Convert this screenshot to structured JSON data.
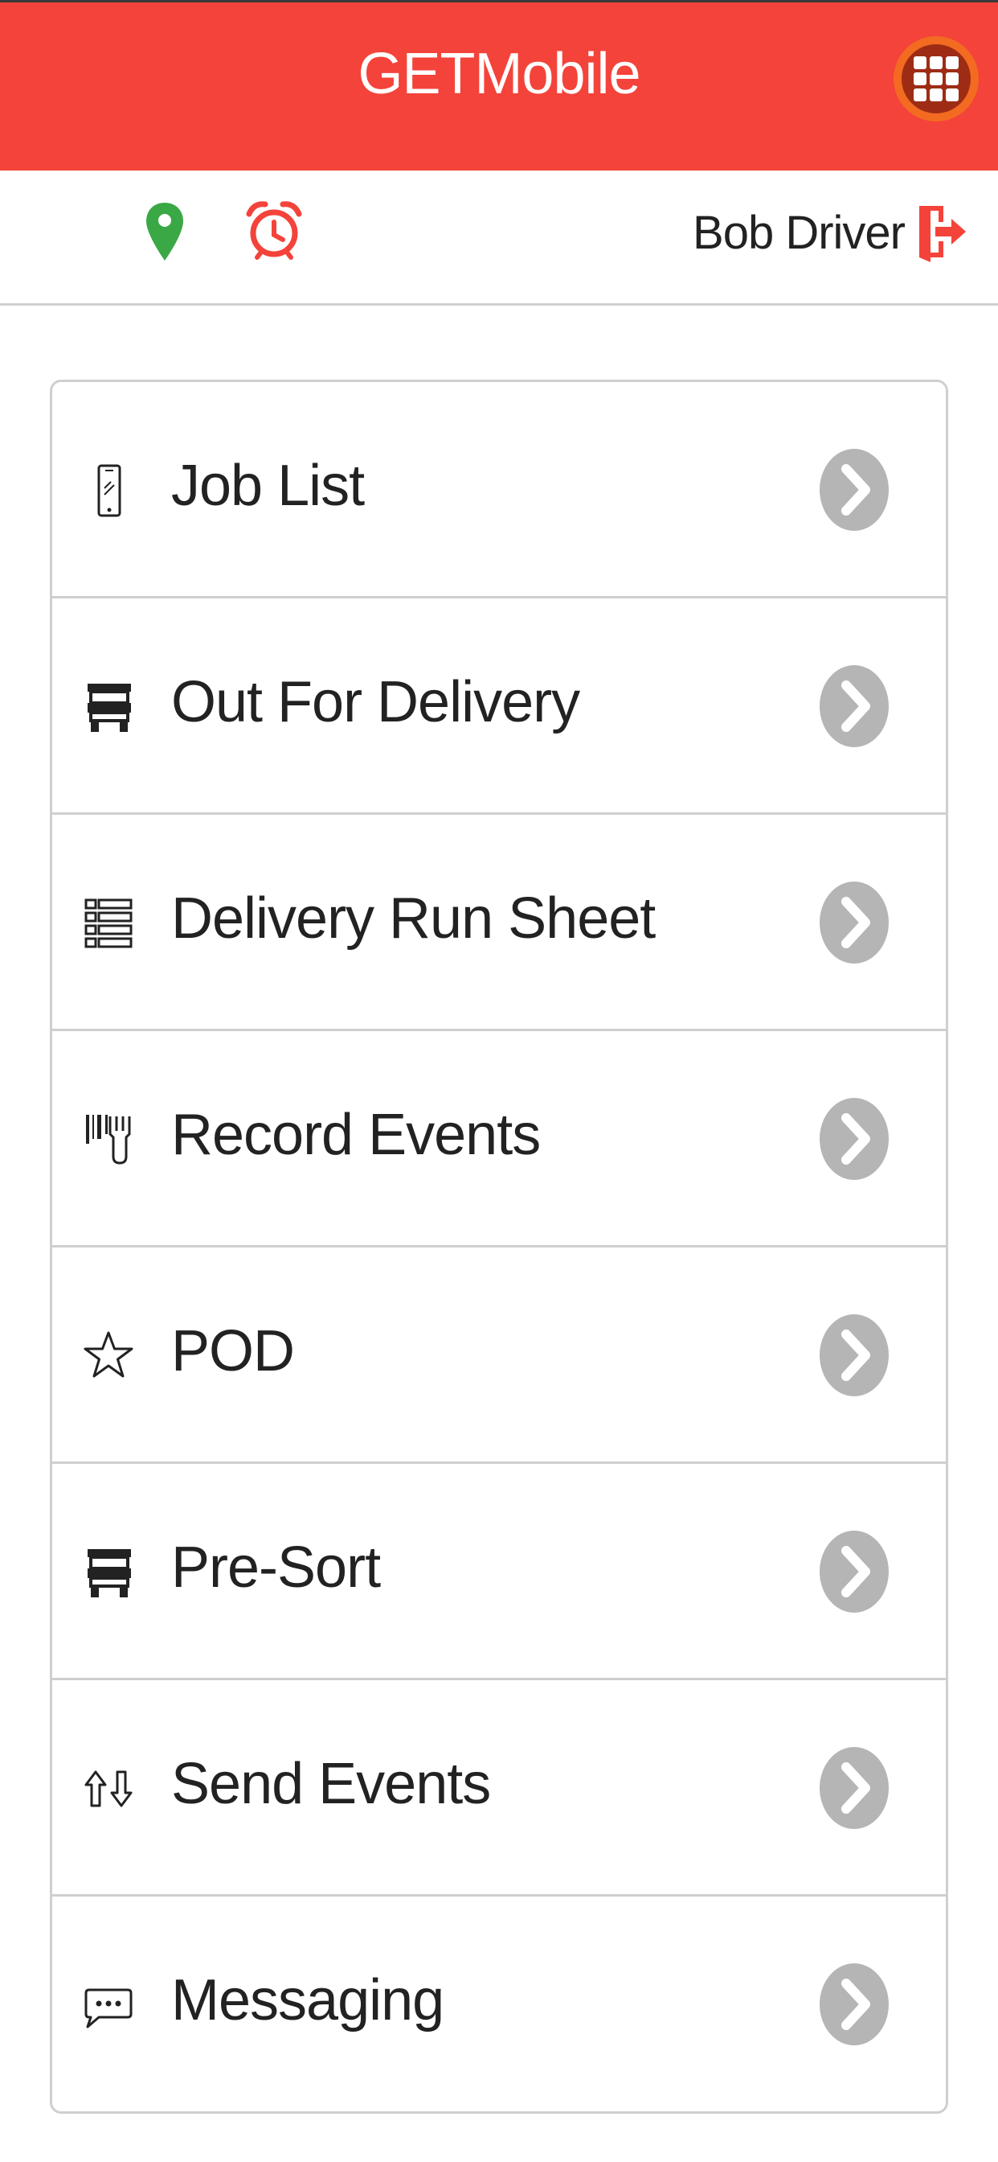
{
  "header": {
    "title": "GETMobile",
    "apps_icon": "grid-icon",
    "colors": {
      "background": "#f4433a",
      "apps_button_ring": "#f36a21",
      "apps_button_fill": "#9e2c15"
    }
  },
  "status_bar": {
    "location_icon": "map-pin-icon",
    "location_color": "#3aa845",
    "alarm_icon": "alarm-clock-icon",
    "alarm_color": "#f4433a",
    "user_name": "Bob Driver",
    "logout_icon": "logout-icon",
    "logout_color": "#f4433a"
  },
  "menu": {
    "items": [
      {
        "label": "Job List",
        "icon": "phone-icon"
      },
      {
        "label": "Out For Delivery",
        "icon": "truck-icon"
      },
      {
        "label": "Delivery Run Sheet",
        "icon": "list-icon"
      },
      {
        "label": "Record Events",
        "icon": "barcode-scanner-icon"
      },
      {
        "label": "POD",
        "icon": "star-icon"
      },
      {
        "label": "Pre-Sort",
        "icon": "truck-icon"
      },
      {
        "label": "Send Events",
        "icon": "upload-download-icon"
      },
      {
        "label": "Messaging",
        "icon": "chat-bubble-icon"
      }
    ],
    "chevron_icon": "chevron-right-icon",
    "chevron_color": "#b5b5b5"
  }
}
